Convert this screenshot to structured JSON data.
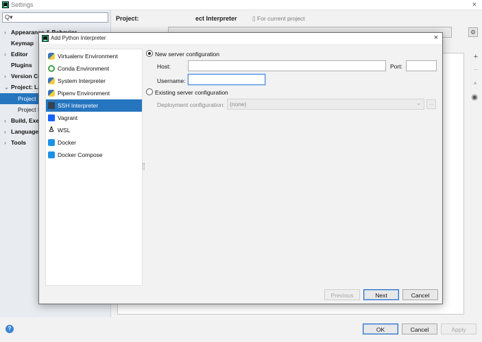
{
  "settings": {
    "title": "Settings",
    "close_icon": "×",
    "search_icon": "Q▾",
    "nav": [
      {
        "label": "Appearance & Behavior",
        "arrow": "›"
      },
      {
        "label": "Keymap",
        "arrow": ""
      },
      {
        "label": "Editor",
        "arrow": "›"
      },
      {
        "label": "Plugins",
        "arrow": ""
      },
      {
        "label": "Version Co",
        "arrow": "›"
      },
      {
        "label": "Project: La",
        "arrow": "⌄"
      },
      {
        "label": "Build, Exe",
        "arrow": "›"
      },
      {
        "label": "Language",
        "arrow": "›"
      },
      {
        "label": "Tools",
        "arrow": "›"
      }
    ],
    "nav_sub": [
      "Project",
      "Project S"
    ],
    "project_label": "Project:",
    "page_heading": "ect Interpreter",
    "for_current_project": "For current project",
    "side_tools": [
      "+",
      "−",
      "▲",
      "◉"
    ],
    "footer": {
      "help": "?",
      "ok": "OK",
      "cancel": "Cancel",
      "apply": "Apply"
    }
  },
  "dialog": {
    "title": "Add Python Interpreter",
    "close_icon": "×",
    "types": [
      {
        "label": "Virtualenv Environment",
        "icon": "python-icon"
      },
      {
        "label": "Conda Environment",
        "icon": "conda-icon"
      },
      {
        "label": "System Interpreter",
        "icon": "python-icon"
      },
      {
        "label": "Pipenv Environment",
        "icon": "python-icon"
      },
      {
        "label": "SSH Interpreter",
        "icon": "terminal-icon"
      },
      {
        "label": "Vagrant",
        "icon": "vagrant-icon"
      },
      {
        "label": "WSL",
        "icon": "linux-icon"
      },
      {
        "label": "Docker",
        "icon": "docker-icon"
      },
      {
        "label": "Docker Compose",
        "icon": "docker-icon"
      }
    ],
    "new_server": "New server configuration",
    "host_label": "Host:",
    "host_value": "",
    "port_label": "Port:",
    "port_value": "",
    "username_label": "Username:",
    "username_value": "",
    "existing_server": "Existing server configuration",
    "deployment_label": "Deployment configuration:",
    "deployment_value": "(none)",
    "dots": "...",
    "buttons": {
      "previous": "Previous",
      "next": "Next",
      "cancel": "Cancel"
    }
  },
  "colors": {
    "selection": "#2675bf",
    "focus": "#4d8ee0"
  }
}
